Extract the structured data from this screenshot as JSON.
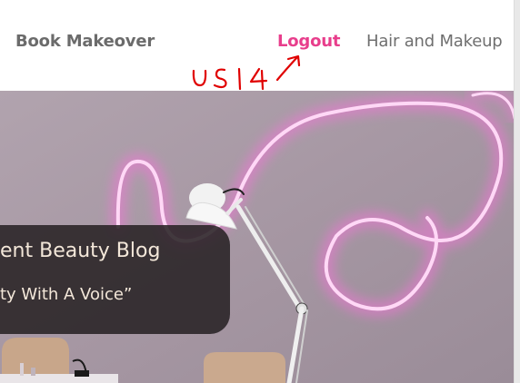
{
  "navbar": {
    "brand": "Book Makeover",
    "logout": "Logout",
    "hair_and_makeup": "Hair and Makeup"
  },
  "annotation": {
    "text": "US14",
    "color": "#e00000"
  },
  "hero": {
    "caption_title": "ent Beauty Blog",
    "caption_subtitle": "ty With A Voice”"
  },
  "colors": {
    "accent": "#e83e8c",
    "neon": "#ff7ae6",
    "wall": "#a89aa6"
  }
}
